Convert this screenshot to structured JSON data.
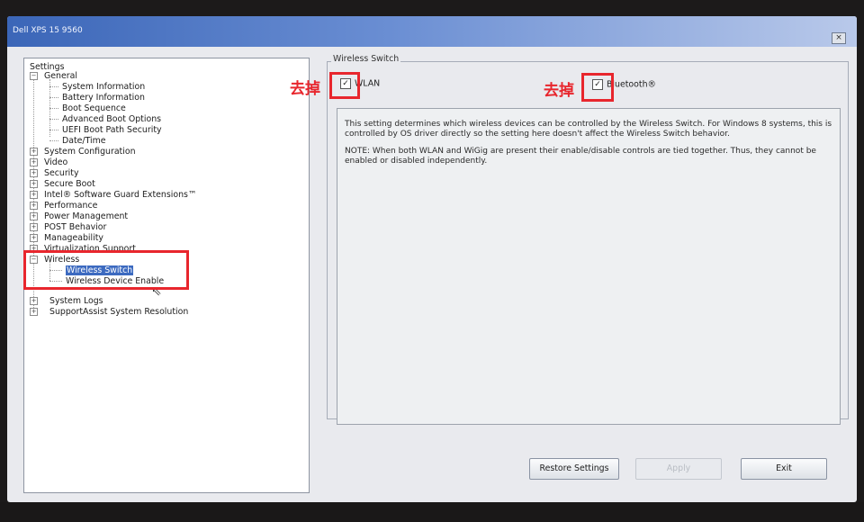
{
  "window": {
    "title": "Dell XPS 15 9560",
    "close_label": "×"
  },
  "tree": {
    "root": "Settings",
    "items": [
      {
        "label": "General",
        "expander": "−"
      },
      {
        "label": "System Information"
      },
      {
        "label": "Battery Information"
      },
      {
        "label": "Boot Sequence"
      },
      {
        "label": "Advanced Boot Options"
      },
      {
        "label": "UEFI Boot Path Security"
      },
      {
        "label": "Date/Time"
      },
      {
        "label": "System Configuration",
        "expander": "+"
      },
      {
        "label": "Video",
        "expander": "+"
      },
      {
        "label": "Security",
        "expander": "+"
      },
      {
        "label": "Secure Boot",
        "expander": "+"
      },
      {
        "label": "Intel® Software Guard Extensions™",
        "expander": "+"
      },
      {
        "label": "Performance",
        "expander": "+"
      },
      {
        "label": "Power Management",
        "expander": "+"
      },
      {
        "label": "POST Behavior",
        "expander": "+"
      },
      {
        "label": "Manageability",
        "expander": "+"
      },
      {
        "label": "Virtualization Support",
        "expander": "+"
      },
      {
        "label": "Wireless",
        "expander": "−"
      },
      {
        "label": "Wireless Switch",
        "selected": true
      },
      {
        "label": "Wireless Device Enable"
      },
      {
        "label": "System Logs",
        "expander": "+"
      },
      {
        "label": "SupportAssist System Resolution",
        "expander": "+"
      }
    ]
  },
  "main": {
    "group_title": "Wireless Switch",
    "checkboxes": [
      {
        "label": "WLAN",
        "checked": true,
        "mark": "✓"
      },
      {
        "label": "Bluetooth®",
        "checked": true,
        "mark": "✓"
      }
    ],
    "description": [
      "This setting determines which wireless devices can be controlled by the Wireless Switch. For Windows 8 systems, this is controlled by OS driver directly so the setting here doesn't affect the Wireless Switch behavior.",
      "NOTE: When both WLAN and WiGig are present their enable/disable controls are tied together.  Thus, they cannot be enabled or disabled independently."
    ]
  },
  "buttons": {
    "restore": "Restore Settings",
    "apply": "Apply",
    "exit": "Exit"
  },
  "annotations": {
    "remove_label": "去掉",
    "color": "#e8262d"
  },
  "colors": {
    "title_bar": "#3b66b8",
    "selection": "#3c6ac0"
  }
}
